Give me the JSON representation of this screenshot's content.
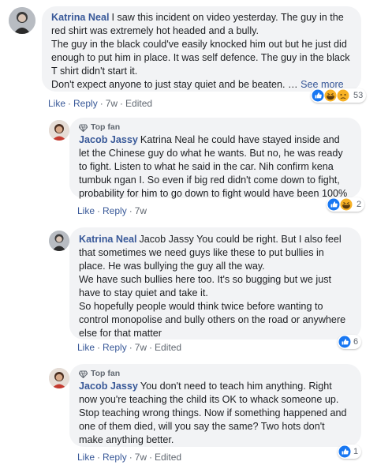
{
  "comments": [
    {
      "author": "Katrina Neal",
      "lines": [
        "I saw this incident on video yesterday. The guy in the",
        "red shirt was extremely hot headed and a bully.",
        "The guy in the black could've easily knocked him out but he just did",
        "enough to put him in place. It was self defence. The guy in the black",
        "T shirt didn't start it.",
        "Don't expect anyone to just stay quiet and be beaten. …"
      ],
      "see_more": "See more",
      "actions": {
        "like": "Like",
        "reply": "Reply",
        "time": "7w",
        "edited": "Edited"
      },
      "reaction_count": "53"
    },
    {
      "badge": "Top fan",
      "author": "Jacob Jassy",
      "lines": [
        "Katrina Neal he could have stayed inside and",
        "let the Chinese guy do what he wants. But no, he was ready",
        "to fight. Listen to what he said in the car. Nih confirm kena",
        "tumbuk ngan I. So even if big red didn't come down to fight,",
        "probability for him to go down to fight would have been 100%"
      ],
      "actions": {
        "like": "Like",
        "reply": "Reply",
        "time": "7w"
      },
      "reaction_count": "2"
    },
    {
      "author": "Katrina Neal",
      "lines": [
        "Jacob Jassy You could be right. But I also feel",
        "that sometimes we need guys like these to put bullies in",
        "place. He was bullying the guy all the way.",
        "We have such bullies here too. It's so bugging but we just",
        "have to stay quiet and take it.",
        "So hopefully people would think twice before wanting to",
        "control monopolise and bully others on the road or anywhere",
        "else for that matter"
      ],
      "actions": {
        "like": "Like",
        "reply": "Reply",
        "time": "7w",
        "edited": "Edited"
      },
      "reaction_count": "6"
    },
    {
      "badge": "Top fan",
      "author": "Jacob Jassy",
      "lines": [
        "You don't need to teach him anything. Right",
        "now you're teaching the child its OK to whack someone up.",
        "Stop teaching wrong things. Now if something happened and",
        "one of them died, will you say the same? Two hots don't",
        "make anything better."
      ],
      "actions": {
        "like": "Like",
        "reply": "Reply",
        "time": "7w",
        "edited": "Edited"
      },
      "reaction_count": "1"
    }
  ],
  "colors": {
    "link": "#385898",
    "bubble": "#f2f3f5",
    "meta": "#606770",
    "like_blue": "#1877f2",
    "haha_yellow": "#f7b125"
  },
  "icons": {
    "badge": "diamond-icon",
    "reactions": [
      "like-reaction-icon",
      "haha-reaction-icon",
      "sad-reaction-icon"
    ]
  }
}
